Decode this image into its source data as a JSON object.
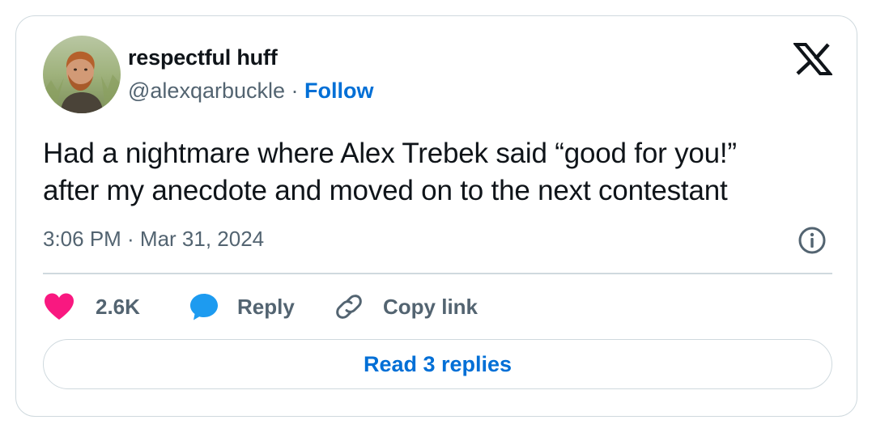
{
  "tweet": {
    "author": {
      "display_name": "respectful huff",
      "handle": "@alexqarbuckle",
      "separator": " · ",
      "follow_label": "Follow",
      "avatar_icon": "profile-photo"
    },
    "platform_icon": "x-logo-icon",
    "text_lines": [
      "Had a nightmare where Alex Trebek said “good for you!”",
      "after my anecdote and moved on to the next contestant"
    ],
    "timestamp": "3:06 PM · Mar 31, 2024",
    "info_icon": "info-icon",
    "actions": {
      "like": {
        "icon": "heart-icon",
        "count": "2.6K",
        "color": "#f91880"
      },
      "reply": {
        "icon": "speech-bubble-icon",
        "label": "Reply",
        "color": "#1d9bf0"
      },
      "copy_link": {
        "icon": "link-icon",
        "label": "Copy link"
      }
    },
    "read_replies_label": "Read 3 replies"
  },
  "colors": {
    "text_primary": "#0f1419",
    "text_secondary": "#536471",
    "link_blue": "#006fd6",
    "border": "#cfd9de"
  }
}
